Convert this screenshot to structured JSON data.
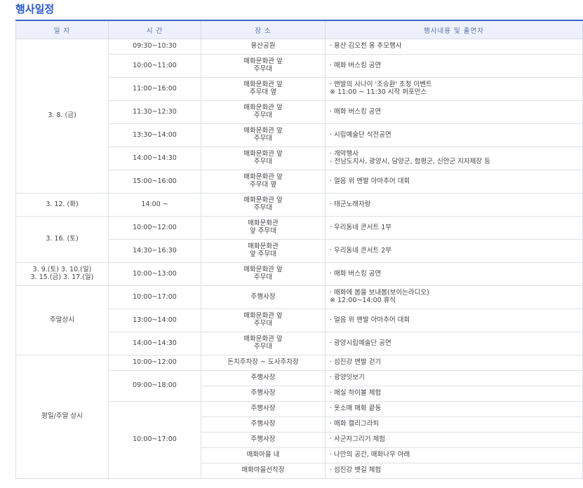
{
  "page_title": "행사일정",
  "headers": [
    "일 자",
    "시 간",
    "장 소",
    "행사내용 및 출연자"
  ],
  "rows": [
    {
      "date": "3. 8. (금)",
      "date_span": 7,
      "time": "09:30~10:30",
      "place": [
        "용산공원"
      ],
      "desc": [
        "· 용산 김오천 옹 추모행사"
      ]
    },
    {
      "time": "10:00~11:00",
      "place": [
        "매화문화관 앞",
        "주무대"
      ],
      "desc": [
        "· 매화 버스킹 공연"
      ]
    },
    {
      "time": "11:00~16:00",
      "place": [
        "매화문화관 앞",
        "주무대 옆"
      ],
      "desc": [
        "· 맨발의 사나이 '조승환' 초청 이벤트",
        "※ 11:00 ~ 11:30 시작 퍼포먼스"
      ]
    },
    {
      "time": "11:30~12:30",
      "place": [
        "매화문화관 앞",
        "주무대"
      ],
      "desc": [
        "· 매화 버스킹 공연"
      ]
    },
    {
      "time": "13:30~14:00",
      "place": [
        "매화문화관 앞",
        "주무대"
      ],
      "desc": [
        "· 시립예술단 식전공연"
      ]
    },
    {
      "time": "14:00~14:30",
      "place": [
        "매화문화관 앞",
        "주무대"
      ],
      "desc": [
        "· 개막행사",
        "- 전남도지사, 광양시, 담양군, 함평군, 신안군 지자체장 등"
      ]
    },
    {
      "time": "15:00~16:00",
      "place": [
        "매화문화관 앞",
        "주무대 옆"
      ],
      "desc": [
        "· 얼음 위 맨발 아마추어 대회"
      ]
    },
    {
      "date": "3. 12. (화)",
      "date_span": 1,
      "time": "14:00 ~",
      "place": [
        "매화문화관 앞",
        "주무대"
      ],
      "desc": [
        "· 태군노래자랑"
      ]
    },
    {
      "date": "3. 16. (토)",
      "date_span": 2,
      "time": "10:00~12:00",
      "place": [
        "매화문화관",
        "앞 주무대"
      ],
      "desc": [
        "· 우리동네 콘서트 1부"
      ]
    },
    {
      "time": "14:30~16:30",
      "place": [
        "매화문화관",
        "앞 주무대"
      ],
      "desc": [
        "· 우리동네 콘서트 2부"
      ]
    },
    {
      "date": "3. 9.(토) 3. 10.(일)\n3. 15.(금) 3. 17.(일)",
      "date_lines": [
        "3. 9.(토) 3. 10.(일)",
        "3. 15.(금) 3. 17.(일)"
      ],
      "date_span": 1,
      "time": "10:00~13:00",
      "place": [
        "매화문화관 앞",
        "주무대"
      ],
      "desc": [
        "· 매화 버스킹 공연"
      ]
    },
    {
      "date": "주말상시",
      "date_span": 3,
      "time": "10:00~17:00",
      "place": [
        "주행사장"
      ],
      "desc": [
        "· 매화에 봄을 보내봄(보이는라디오)",
        "※ 12:00~14:00 휴식"
      ]
    },
    {
      "time": "13:00~14:00",
      "place": [
        "매화문화관 앞",
        "주무대"
      ],
      "desc": [
        "· 얼음 위 맨발 아마추어 대회"
      ]
    },
    {
      "time": "14:00~14:30",
      "place": [
        "매화문화관 앞",
        "주무대"
      ],
      "desc": [
        "· 광양시립예술단 공연"
      ]
    },
    {
      "date": "평일/주말 상시",
      "date_span": 8,
      "time": "10:00~12:00",
      "time_span": 1,
      "place": [
        "돈치주차장 ~ 도사주차장"
      ],
      "desc": [
        "· 섬진강 맨발 걷기"
      ]
    },
    {
      "time": "09:00~18:00",
      "time_span": 2,
      "place": [
        "주행사장"
      ],
      "desc": [
        "· 광양잇보기"
      ]
    },
    {
      "place": [
        "주행사장"
      ],
      "desc": [
        "· 매실 하이볼 체험"
      ]
    },
    {
      "time": "10:00~17:00",
      "time_span": 5,
      "place": [
        "주행사장"
      ],
      "desc": [
        "· 옷소매 매화 끝동"
      ]
    },
    {
      "place": [
        "주행사장"
      ],
      "desc": [
        "· 매화 캘리그라피"
      ]
    },
    {
      "place": [
        "주행사장"
      ],
      "desc": [
        "· 사군자그리기 체험"
      ]
    },
    {
      "place": [
        "매화마을 내"
      ],
      "desc": [
        "· 나만의 공간, 매화나무 아래"
      ]
    },
    {
      "place": [
        "매화마을선착장"
      ],
      "desc": [
        "· 섬진강 뱃길 체험"
      ]
    }
  ]
}
